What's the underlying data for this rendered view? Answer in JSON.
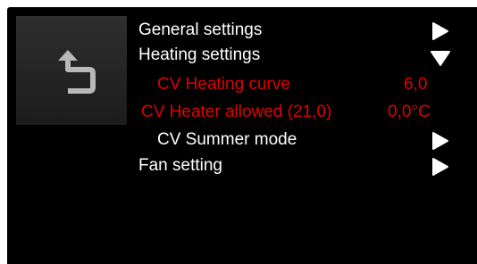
{
  "menu": {
    "back_icon": "undo-back-arrow-icon",
    "items": [
      {
        "label": "General settings",
        "value": "",
        "indicator": "play-right-icon",
        "color": "#ffffff"
      },
      {
        "label": "Heating settings",
        "value": "",
        "indicator": "triangle-down-icon",
        "color": "#ffffff"
      },
      {
        "label": "CV Heating curve",
        "value": "6,0",
        "indicator": "",
        "color": "#e00000"
      },
      {
        "label": "CV Heater allowed (21,0)",
        "value": "0,0°C",
        "indicator": "",
        "color": "#e00000"
      },
      {
        "label": "CV Summer mode",
        "value": "",
        "indicator": "play-right-icon",
        "color": "#ffffff"
      },
      {
        "label": "Fan setting",
        "value": "",
        "indicator": "play-right-icon",
        "color": "#ffffff"
      }
    ]
  }
}
